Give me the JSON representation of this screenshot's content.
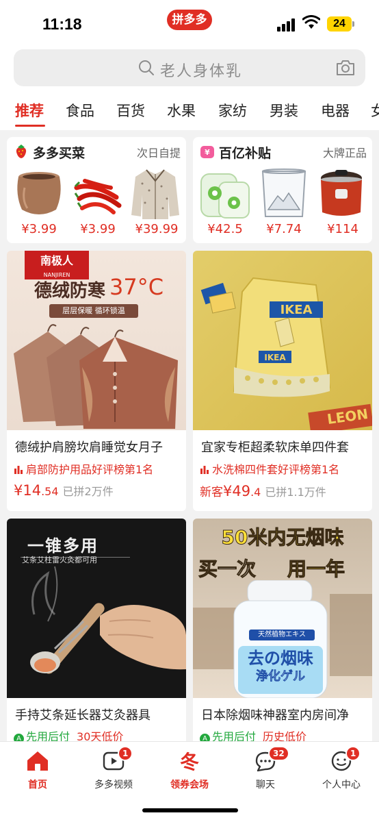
{
  "status_bar": {
    "time": "11:18",
    "app_badge": "拼多多",
    "battery": "24"
  },
  "search": {
    "placeholder": "老人身体乳"
  },
  "tabs": [
    "推荐",
    "食品",
    "百货",
    "水果",
    "家纺",
    "男装",
    "电器",
    "女"
  ],
  "active_tab": "推荐",
  "promos": {
    "left": {
      "title": "多多买菜",
      "subtitle": "次日自提",
      "items": [
        {
          "icon": "clay-pot",
          "price": "¥3.99"
        },
        {
          "icon": "red-chili-peppers",
          "price": "¥3.99"
        },
        {
          "icon": "tweed-jacket",
          "price": "¥39.99"
        }
      ]
    },
    "right": {
      "title": "百亿补贴",
      "subtitle": "大牌正品",
      "items": [
        {
          "icon": "laundry-pods",
          "price": "¥42.5"
        },
        {
          "icon": "glass-cup",
          "price": "¥7.74"
        },
        {
          "icon": "pressure-cooker",
          "price": "¥114"
        }
      ]
    }
  },
  "products": [
    {
      "image_brand": "南极人",
      "image_brand_en": "NANJIREN",
      "image_headline": "德绒防寒",
      "image_temp": "37°C",
      "image_tag": "层层保暖 循环锁温",
      "title": "德绒护肩膀坎肩睡觉女月子",
      "rank": "肩部防护用品好评榜第1名",
      "price_main": "¥14",
      "price_decimal": ".54",
      "sold": "已拼2万件"
    },
    {
      "image_brand": "IKEA",
      "image_tag": "LEON",
      "title": "宜家专柜超柔软床单四件套",
      "rank": "水洗棉四件套好评榜第1名",
      "new_tag": "新客",
      "price_main": "¥49",
      "price_decimal": ".4",
      "sold": "已拼1.1万件"
    },
    {
      "image_headline": "一锥多用",
      "image_sub": "艾条艾柱雷火灸都可用",
      "title": "手持艾条延长器艾灸器具",
      "pay_label": "先用后付",
      "pay_extra": "30天低价"
    },
    {
      "image_headline1": "50米内无烟味",
      "image_headline2a": "买一次",
      "image_headline2b": "用一年",
      "image_label1": "去の烟味",
      "image_label2": "浄化ゲル",
      "image_label3": "天然植物エキス",
      "title": "日本除烟味神器室内房间净",
      "pay_label": "先用后付",
      "pay_extra": "历史低价"
    }
  ],
  "bottom_nav": [
    {
      "label": "首页",
      "icon": "home-icon",
      "badge": null
    },
    {
      "label": "多多视频",
      "icon": "video-icon",
      "badge": "1"
    },
    {
      "label": "领券会场",
      "icon": "coupon-icon",
      "badge": null
    },
    {
      "label": "聊天",
      "icon": "chat-icon",
      "badge": "32"
    },
    {
      "label": "个人中心",
      "icon": "profile-icon",
      "badge": "1"
    }
  ],
  "colors": {
    "brand": "#e02e24",
    "green": "#22a83d"
  }
}
